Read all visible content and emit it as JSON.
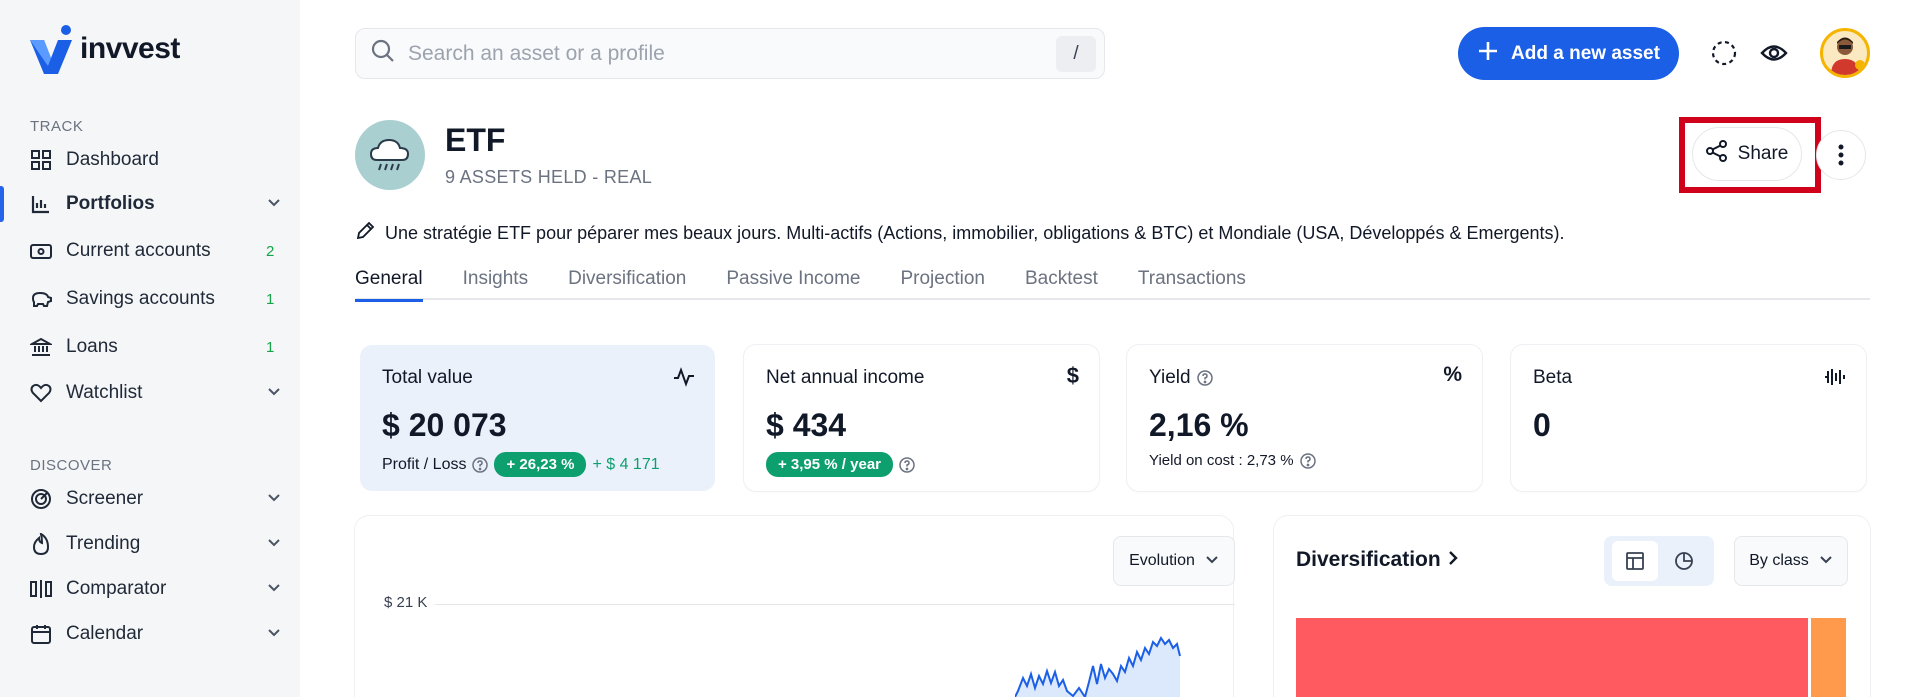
{
  "app": {
    "name": "invvest"
  },
  "sidebar": {
    "track_label": "TRACK",
    "discover_label": "DISCOVER",
    "track_items": [
      {
        "label": "Dashboard",
        "icon": "grid-icon"
      },
      {
        "label": "Portfolios",
        "icon": "bar-chart-icon",
        "active": true
      },
      {
        "label": "Current accounts",
        "icon": "wallet-icon",
        "badge": "2"
      },
      {
        "label": "Savings accounts",
        "icon": "piggy-bank-icon",
        "badge": "1"
      },
      {
        "label": "Loans",
        "icon": "bank-icon",
        "badge": "1"
      },
      {
        "label": "Watchlist",
        "icon": "heart-icon"
      }
    ],
    "discover_items": [
      {
        "label": "Screener",
        "icon": "radar-icon"
      },
      {
        "label": "Trending",
        "icon": "flame-icon"
      },
      {
        "label": "Comparator",
        "icon": "compare-icon"
      },
      {
        "label": "Calendar",
        "icon": "calendar-icon"
      }
    ]
  },
  "topbar": {
    "search_placeholder": "Search an asset or a profile",
    "search_shortcut": "/",
    "add_button": "Add a new asset"
  },
  "portfolio": {
    "title": "ETF",
    "subtitle": "9 ASSETS HELD - REAL",
    "share_label": "Share",
    "description": "Une stratégie ETF pour péparer mes beaux jours. Multi-actifs (Actions, immobilier, obligations & BTC) et Mondiale (USA, Développés & Emergents)."
  },
  "tabs": [
    "General",
    "Insights",
    "Diversification",
    "Passive Income",
    "Projection",
    "Backtest",
    "Transactions"
  ],
  "cards": {
    "total": {
      "label": "Total value",
      "value": "$ 20 073",
      "pl_label": "Profit / Loss",
      "pl_pct": "+ 26,23 %",
      "pl_abs": "+ $ 4 171"
    },
    "income": {
      "label": "Net annual income",
      "value": "$ 434",
      "rate": "+ 3,95 % / year"
    },
    "yield": {
      "label": "Yield",
      "value": "2,16 %",
      "yoc": "Yield on cost : 2,73 %"
    },
    "beta": {
      "label": "Beta",
      "value": "0"
    }
  },
  "chart": {
    "dropdown": "Evolution",
    "y_tick": "$ 21 K"
  },
  "diversification": {
    "title": "Diversification",
    "dropdown": "By class"
  },
  "colors": {
    "accent": "#1b5fe6",
    "positive": "#0e9f6e",
    "treemap_red": "#ff5a5f",
    "treemap_orange": "#ff9a4d",
    "highlight_border": "#d0021b"
  }
}
